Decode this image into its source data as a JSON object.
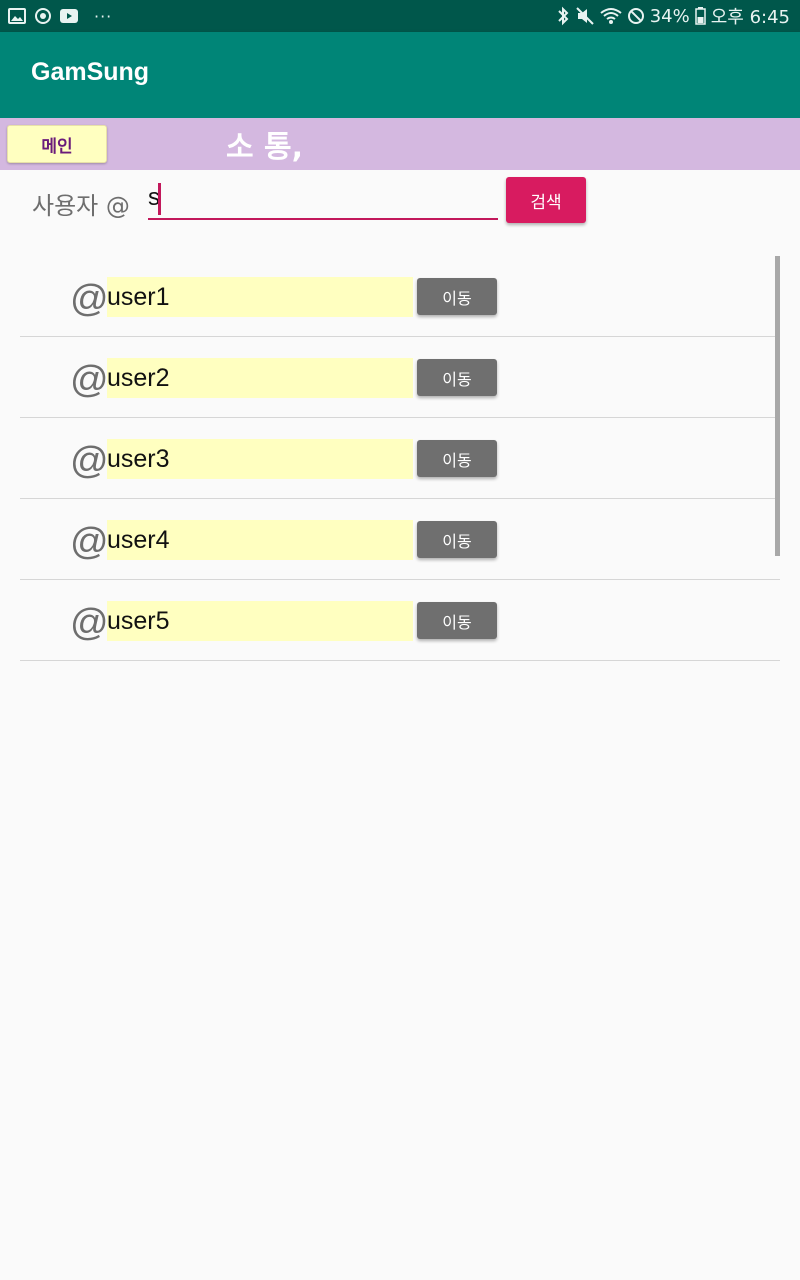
{
  "status_bar": {
    "battery_percent": "34%",
    "time": "오후 6:45",
    "icons_left": [
      "gallery-icon",
      "sync-icon",
      "youtube-icon"
    ],
    "more": "···",
    "icons_right": [
      "bluetooth-icon",
      "mute-icon",
      "wifi-icon",
      "blocked-icon",
      "battery-icon"
    ]
  },
  "app_bar": {
    "title": "GamSung"
  },
  "header": {
    "main_button_label": "메인",
    "title": "소 통,"
  },
  "search": {
    "label": "사용자 @",
    "value": "s",
    "button_label": "검색"
  },
  "users": [
    {
      "at": "@",
      "name": "user1",
      "button_label": "이동"
    },
    {
      "at": "@",
      "name": "user2",
      "button_label": "이동"
    },
    {
      "at": "@",
      "name": "user3",
      "button_label": "이동"
    },
    {
      "at": "@",
      "name": "user4",
      "button_label": "이동"
    },
    {
      "at": "@",
      "name": "user5",
      "button_label": "이동"
    }
  ],
  "colors": {
    "status_bar": "#00574b",
    "app_bar": "#008577",
    "header_bg": "#d4b8e0",
    "accent": "#d81b60",
    "name_highlight": "#ffffc0",
    "go_button": "#6f6f6f"
  }
}
